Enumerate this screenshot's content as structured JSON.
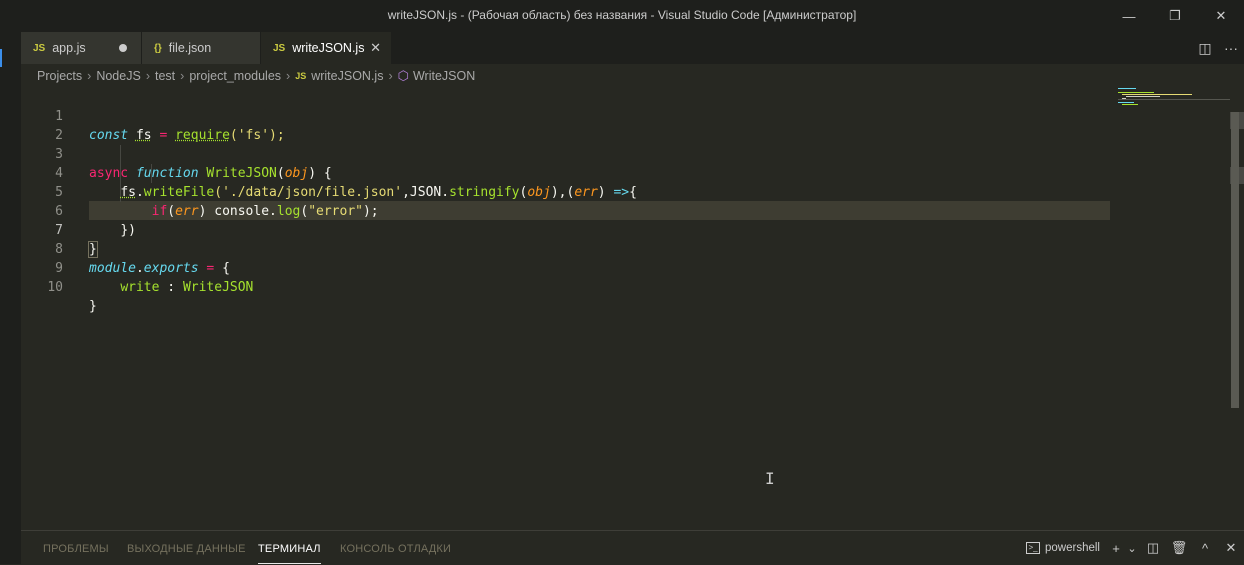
{
  "window": {
    "title": "writeJSON.js - (Рабочая область) без названия - Visual Studio Code [Администратор]",
    "min_glyph": "—",
    "max_glyph": "❐",
    "close_glyph": "✕"
  },
  "tabs": [
    {
      "icon_text": "JS",
      "icon": "js-file-icon",
      "label": "app.js",
      "modified": true
    },
    {
      "icon_text": "{}",
      "icon": "json-file-icon",
      "label": "file.json",
      "modified": false
    },
    {
      "icon_text": "JS",
      "icon": "js-file-icon",
      "label": "writeJSON.js",
      "active": true
    }
  ],
  "tab_actions": {
    "split": "◫",
    "more": "···",
    "close": "✕"
  },
  "breadcrumbs": {
    "items": [
      "Projects",
      "NodeJS",
      "test",
      "project_modules",
      "writeJSON.js",
      "WriteJSON"
    ],
    "file_icon_text": "JS",
    "symbol_glyph": "⬡"
  },
  "editor": {
    "line_numbers": [
      "1",
      "2",
      "3",
      "4",
      "5",
      "6",
      "7",
      "8",
      "9",
      "10"
    ],
    "current_line": 7,
    "code": {
      "l1": {
        "t1": "const",
        "t2": "fs",
        "t3": " = ",
        "t4": "require",
        "t5": "('fs');"
      },
      "l3": {
        "t1": "async",
        "t2": "function",
        "t3": "WriteJSON",
        "t4": "(",
        "t5": "obj",
        "t6": ") {"
      },
      "l4": {
        "t1": "fs",
        "t2": ".",
        "t3": "writeFile",
        "t4": "('./data/json/file.json'",
        "t5": ",JSON.",
        "t6": "stringify",
        "t7": "(",
        "t8": "obj",
        "t9": "),(",
        "t10": "err",
        "t11": ") ",
        "t12": "=>",
        "t13": "{"
      },
      "l5": {
        "t1": "if",
        "t2": "(",
        "t3": "err",
        "t4": ") console.",
        "t5": "log",
        "t6": "(",
        "t7": "\"error\"",
        "t8": ");"
      },
      "l6": {
        "t1": "})"
      },
      "l7": {
        "t1": "}"
      },
      "l8": {
        "t1": "module",
        "t2": ".",
        "t3": "exports",
        "t4": " = ",
        "t5": "{"
      },
      "l9": {
        "t1": "write",
        "t2": " : ",
        "t3": "WriteJSON"
      },
      "l10": {
        "t1": "}"
      }
    }
  },
  "panel": {
    "tabs": [
      "ПРОБЛЕМЫ",
      "ВЫХОДНЫЕ ДАННЫЕ",
      "ТЕРМИНАЛ",
      "КОНСОЛЬ ОТЛАДКИ"
    ],
    "active_tab": "ТЕРМИНАЛ",
    "terminal_label": "powershell",
    "terminal_icon_text": ">_",
    "actions": {
      "add": "+",
      "dropdown": "⌄",
      "split": "◫",
      "kill": "🗑",
      "maximize": "^",
      "close": "✕"
    }
  },
  "cursor_glyph": "I"
}
